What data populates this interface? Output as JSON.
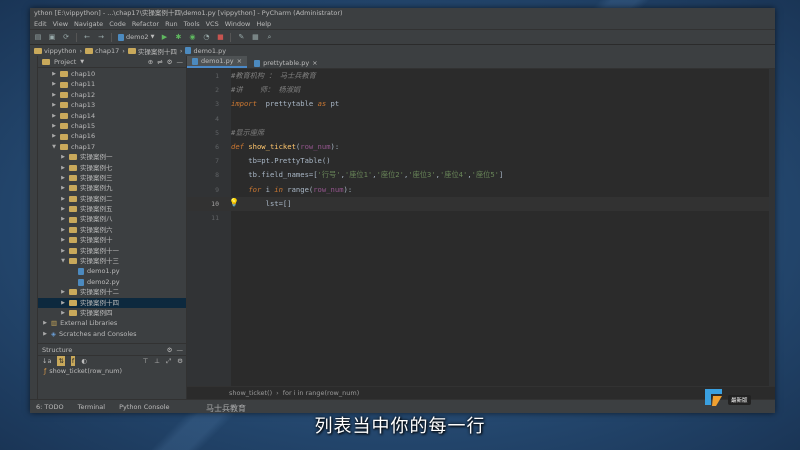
{
  "window": {
    "title": "ython [E:\\vippython] - ...\\chap17\\实操案例十四\\demo1.py [vippython] - PyCharm (Administrator)"
  },
  "menu": [
    "Edit",
    "View",
    "Navigate",
    "Code",
    "Refactor",
    "Run",
    "Tools",
    "VCS",
    "Window",
    "Help"
  ],
  "toolbar": {
    "run_config": "demo2"
  },
  "navbar": [
    "vippython",
    "chap17",
    "实操案例十四",
    "demo1.py"
  ],
  "project_panel": {
    "title": "Project",
    "tree": [
      {
        "label": "chap10",
        "indent": 1,
        "type": "folder",
        "expanded": false,
        "selected": false
      },
      {
        "label": "chap11",
        "indent": 1,
        "type": "folder",
        "expanded": false,
        "selected": false
      },
      {
        "label": "chap12",
        "indent": 1,
        "type": "folder",
        "expanded": false,
        "selected": false
      },
      {
        "label": "chap13",
        "indent": 1,
        "type": "folder",
        "expanded": false,
        "selected": false
      },
      {
        "label": "chap14",
        "indent": 1,
        "type": "folder",
        "expanded": false,
        "selected": false
      },
      {
        "label": "chap15",
        "indent": 1,
        "type": "folder",
        "expanded": false,
        "selected": false
      },
      {
        "label": "chap16",
        "indent": 1,
        "type": "folder",
        "expanded": false,
        "selected": false
      },
      {
        "label": "chap17",
        "indent": 1,
        "type": "folder",
        "expanded": true,
        "selected": false
      },
      {
        "label": "实操案例一",
        "indent": 2,
        "type": "folder",
        "expanded": false,
        "selected": false
      },
      {
        "label": "实操案例七",
        "indent": 2,
        "type": "folder",
        "expanded": false,
        "selected": false
      },
      {
        "label": "实操案例三",
        "indent": 2,
        "type": "folder",
        "expanded": false,
        "selected": false
      },
      {
        "label": "实操案例九",
        "indent": 2,
        "type": "folder",
        "expanded": false,
        "selected": false
      },
      {
        "label": "实操案例二",
        "indent": 2,
        "type": "folder",
        "expanded": false,
        "selected": false
      },
      {
        "label": "实操案例五",
        "indent": 2,
        "type": "folder",
        "expanded": false,
        "selected": false
      },
      {
        "label": "实操案例八",
        "indent": 2,
        "type": "folder",
        "expanded": false,
        "selected": false
      },
      {
        "label": "实操案例六",
        "indent": 2,
        "type": "folder",
        "expanded": false,
        "selected": false
      },
      {
        "label": "实操案例十",
        "indent": 2,
        "type": "folder",
        "expanded": false,
        "selected": false
      },
      {
        "label": "实操案例十一",
        "indent": 2,
        "type": "folder",
        "expanded": false,
        "selected": false
      },
      {
        "label": "实操案例十三",
        "indent": 2,
        "type": "folder",
        "expanded": true,
        "selected": false
      },
      {
        "label": "demo1.py",
        "indent": 3,
        "type": "file",
        "expanded": false,
        "selected": false
      },
      {
        "label": "demo2.py",
        "indent": 3,
        "type": "file",
        "expanded": false,
        "selected": false
      },
      {
        "label": "实操案例十二",
        "indent": 2,
        "type": "folder",
        "expanded": false,
        "selected": false
      },
      {
        "label": "实操案例十四",
        "indent": 2,
        "type": "folder",
        "expanded": false,
        "selected": true
      },
      {
        "label": "实操案例四",
        "indent": 2,
        "type": "folder",
        "expanded": false,
        "selected": false
      },
      {
        "label": "External Libraries",
        "indent": 0,
        "type": "lib",
        "expanded": false,
        "selected": false
      },
      {
        "label": "Scratches and Consoles",
        "indent": 0,
        "type": "scratch",
        "expanded": false,
        "selected": false
      }
    ]
  },
  "structure_panel": {
    "title": "Structure",
    "items": [
      "show_ticket(row_num)"
    ]
  },
  "tabs": [
    {
      "label": "demo1.py",
      "active": true
    },
    {
      "label": "prettytable.py",
      "active": false
    }
  ],
  "editor": {
    "line_numbers": [
      "1",
      "2",
      "3",
      "4",
      "5",
      "6",
      "7",
      "8",
      "9",
      "10",
      "11"
    ],
    "current_line": 10
  },
  "breadcrumb": [
    "show_ticket()",
    "for i in range(row_num)"
  ],
  "statusbar": [
    "6: TODO",
    "Terminal",
    "Python Console"
  ],
  "overlay": {
    "subtitle": "列表当中你的每一行",
    "watermark": "马士兵教育",
    "badge": "最新版"
  },
  "colors": {
    "ide_bg": "#2b2b2b",
    "panel_bg": "#3c3f41",
    "selection": "#0d293e",
    "keyword": "#cc7832",
    "string": "#6a8759",
    "comment": "#808080",
    "function": "#ffc66d"
  }
}
